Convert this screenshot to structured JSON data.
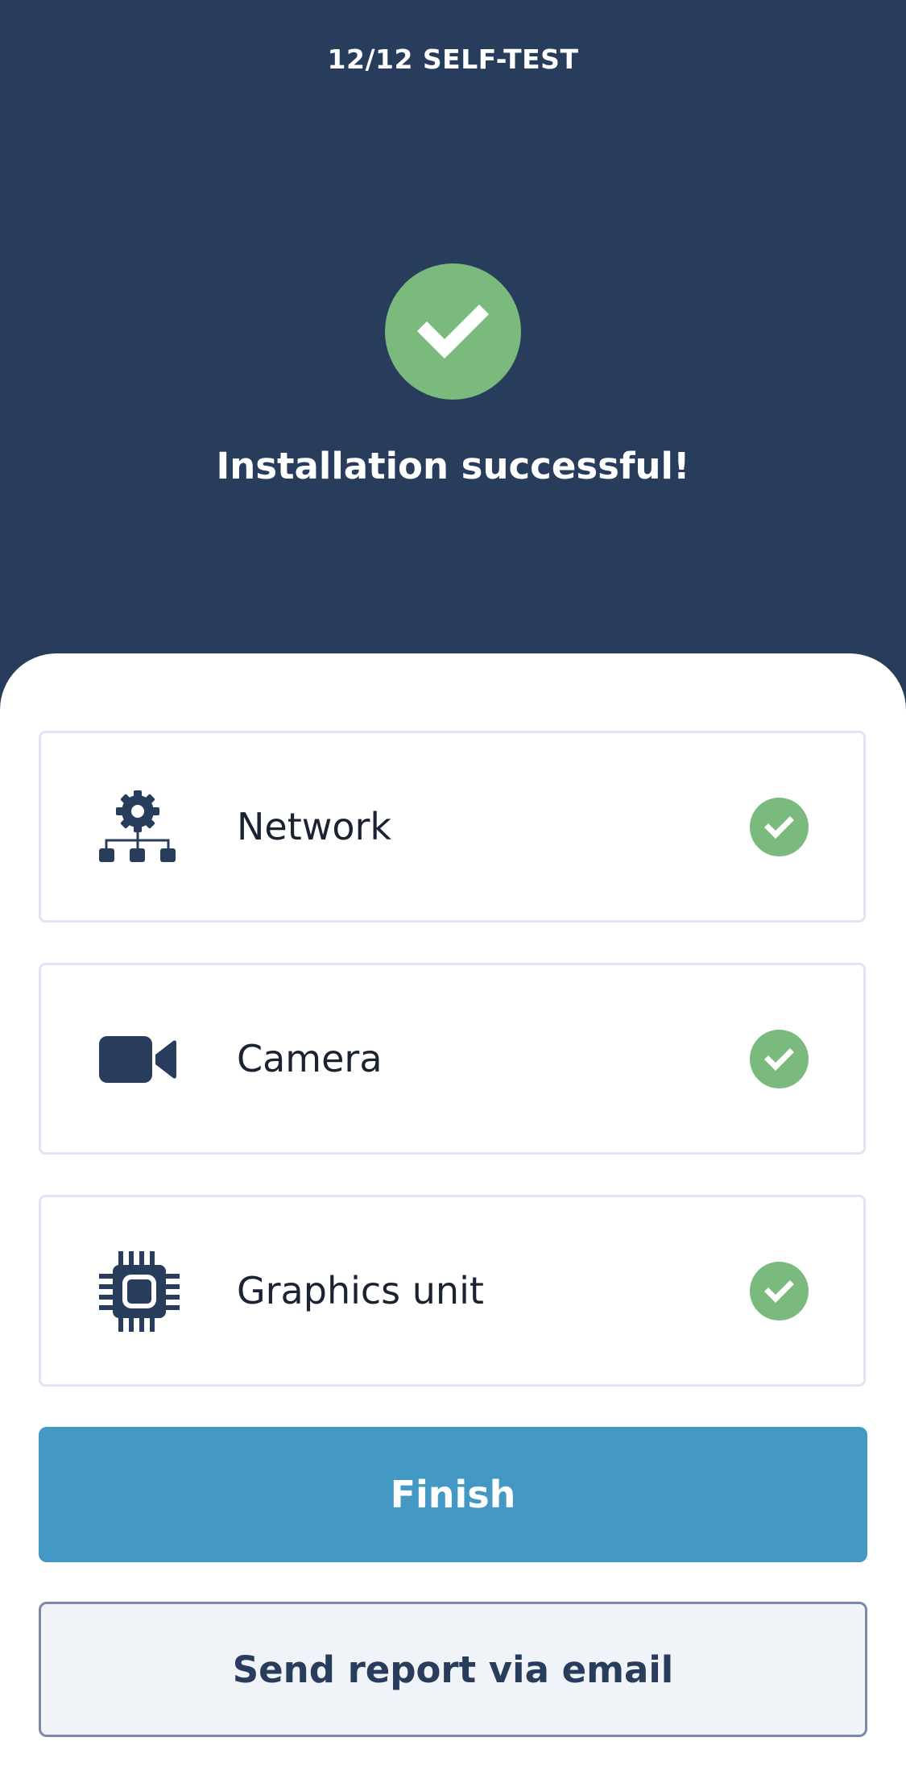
{
  "header": {
    "step_title": "12/12 SELF-TEST",
    "success_title": "Installation successful!",
    "success_icon": "check-icon"
  },
  "checks": [
    {
      "label": "Network",
      "icon": "network-gear-icon",
      "status": "passed"
    },
    {
      "label": "Camera",
      "icon": "video-camera-icon",
      "status": "passed"
    },
    {
      "label": "Graphics unit",
      "icon": "chip-icon",
      "status": "passed"
    }
  ],
  "actions": {
    "finish_label": "Finish",
    "email_label": "Send report via email"
  },
  "colors": {
    "header_bg": "#283c5c",
    "success_green": "#7bba7d",
    "primary_blue": "#4398c4",
    "icon_navy": "#283c5c"
  }
}
